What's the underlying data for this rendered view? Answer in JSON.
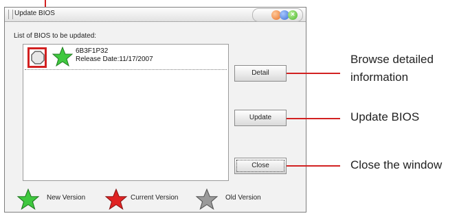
{
  "window": {
    "title": "Update BIOS",
    "close_glyph": "×"
  },
  "list": {
    "label": "List of BIOS to be updated:",
    "items": [
      {
        "name": "6B3F1P32",
        "release": "Release Date:11/17/2007",
        "star": "new"
      }
    ]
  },
  "buttons": {
    "detail": "Detail",
    "update": "Update",
    "close": "Close"
  },
  "legend": [
    {
      "label": "New Version",
      "color": "#3fc83f"
    },
    {
      "label": "Current Version",
      "color": "#e02424"
    },
    {
      "label": "Old Version",
      "color": "#9a9a9a"
    }
  ],
  "annotations": {
    "detail": [
      "Browse detailed",
      "information"
    ],
    "update": "Update BIOS",
    "close": "Close the window"
  },
  "colors": {
    "annotation": "#d22020"
  }
}
